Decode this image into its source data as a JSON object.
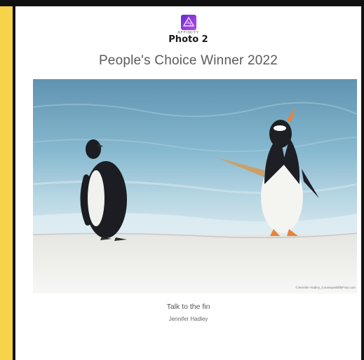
{
  "logo": {
    "icon": "affinity-photo-icon",
    "brand": "AFFINITY",
    "product": "Photo 2"
  },
  "headline": "People's Choice Winner 2022",
  "photo": {
    "subject": "two-penguins-on-beach",
    "copyright": "©Jennifer Hadley_ConwaywildlifeFoto.com"
  },
  "caption": {
    "title": "Talk to the fin",
    "author": "Jennifer Hadley"
  },
  "colors": {
    "frame_yellow": "#f7d34a",
    "frame_black": "#111111",
    "logo_purple": "#8a3fd1",
    "sea": "#7db3cc",
    "sand": "#f2f2f0"
  }
}
